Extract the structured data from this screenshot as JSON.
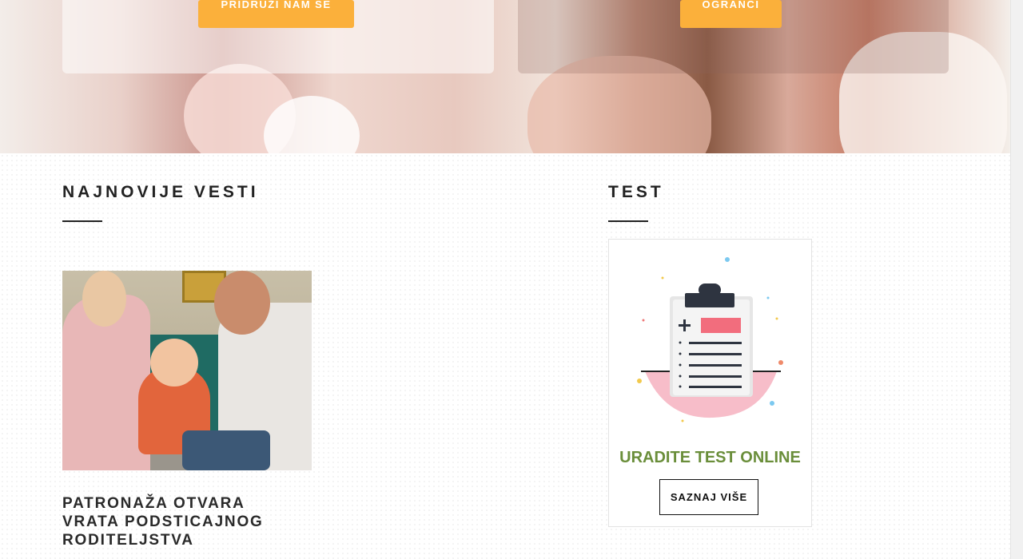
{
  "hero": {
    "join_button_label": "PRIDRUŽI NAM SE",
    "second_button_label": "OGRANCI"
  },
  "news": {
    "section_title": "NAJNOVIJE VESTI",
    "article_title": "PATRONAŽA OTVARA VRATA PODSTICAJNOG RODITELJSTVA"
  },
  "test": {
    "section_title": "TEST",
    "heading": "URADITE TEST ONLINE",
    "button_label": "SAZNAJ VIŠE"
  },
  "colors": {
    "accent_button": "#fbb03b",
    "test_heading": "#6a8e3a",
    "title_text": "#222222"
  },
  "icons": {
    "clipboard": "clipboard-icon"
  }
}
